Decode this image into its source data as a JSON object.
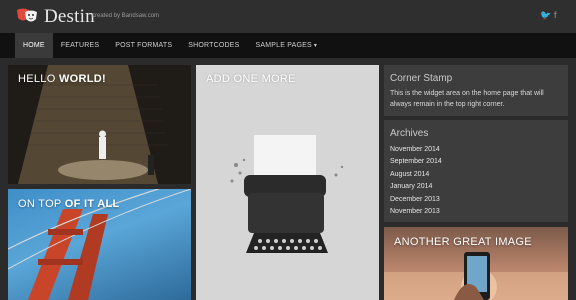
{
  "site": {
    "title": "Destin",
    "tagline": "created by Bandsaw.com"
  },
  "social": {
    "twitter_icon": "twitter-icon",
    "facebook_icon": "facebook-icon"
  },
  "nav": {
    "items": [
      {
        "label": "HOME"
      },
      {
        "label": "FEATURES"
      },
      {
        "label": "POST FORMATS"
      },
      {
        "label": "SHORTCODES"
      },
      {
        "label": "SAMPLE PAGES"
      }
    ]
  },
  "tiles": {
    "hello": {
      "part1": "HELLO ",
      "part2": "WORLD!"
    },
    "ontop": {
      "part1": "ON TOP ",
      "part2": "OF IT ALL"
    },
    "addone": {
      "title": "ADD ONE MORE"
    },
    "another": {
      "title": "ANOTHER GREAT IMAGE"
    }
  },
  "widgets": {
    "corner": {
      "title": "Corner Stamp",
      "text": "This is the widget area on the home page that will always remain in the top right corner."
    },
    "archives": {
      "title": "Archives",
      "items": [
        "November 2014",
        "September 2014",
        "August 2014",
        "January 2014",
        "December 2013",
        "November 2013"
      ]
    }
  },
  "colors": {
    "accent_logo": "#e04a3b",
    "nav_bg": "#111111",
    "widget_bg": "#3d3d3d"
  }
}
